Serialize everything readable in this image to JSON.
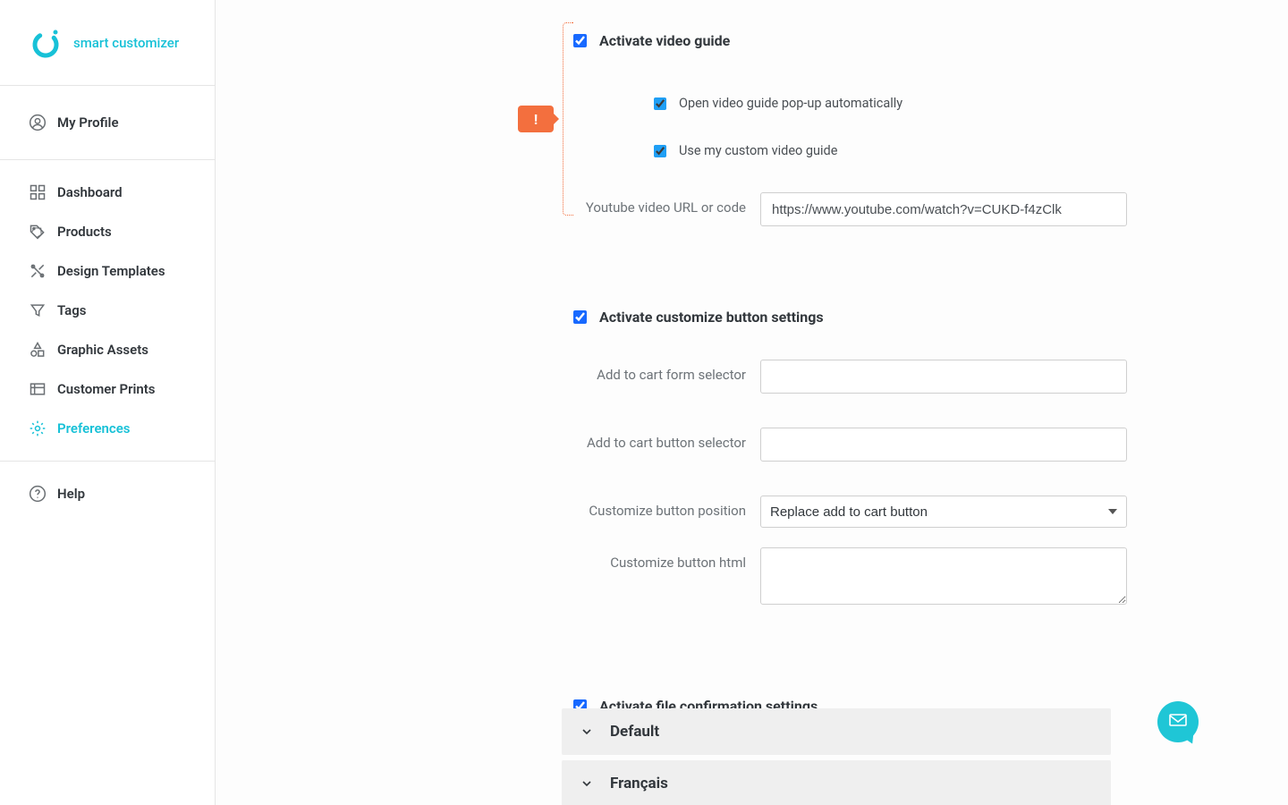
{
  "brand": {
    "name": "smart customizer"
  },
  "sidebar": {
    "profile": "My Profile",
    "items": [
      {
        "label": "Dashboard"
      },
      {
        "label": "Products"
      },
      {
        "label": "Design Templates"
      },
      {
        "label": "Tags"
      },
      {
        "label": "Graphic Assets"
      },
      {
        "label": "Customer Prints"
      },
      {
        "label": "Preferences"
      }
    ],
    "help": "Help"
  },
  "alert_icon": "!",
  "sections": {
    "video": {
      "title": "Activate video guide",
      "auto_popup": "Open video guide pop-up automatically",
      "use_custom": "Use my custom video guide",
      "url_label": "Youtube video URL or code",
      "url_value": "https://www.youtube.com/watch?v=CUKD-f4zClk"
    },
    "button": {
      "title": "Activate customize button settings",
      "form_selector_label": "Add to cart form selector",
      "form_selector_value": "",
      "button_selector_label": "Add to cart button selector",
      "button_selector_value": "",
      "position_label": "Customize button position",
      "position_value": "Replace add to cart button",
      "html_label": "Customize button html",
      "html_value": ""
    },
    "file": {
      "title": "Activate file confirmation settings"
    }
  },
  "accordion": {
    "default": "Default",
    "second": "Français"
  }
}
